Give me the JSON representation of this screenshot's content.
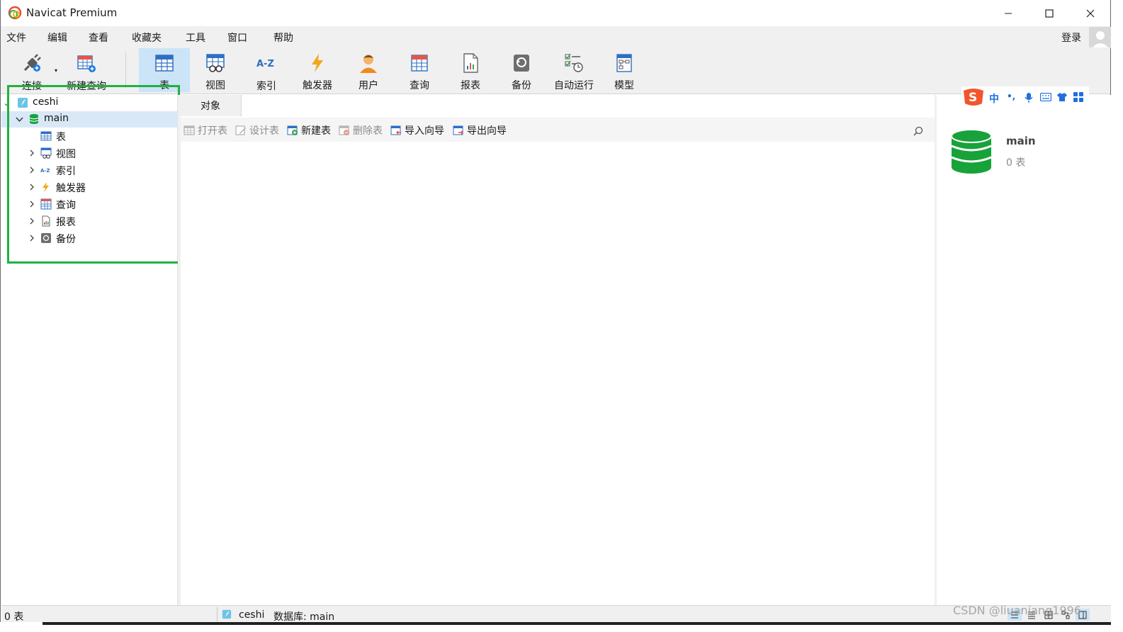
{
  "window": {
    "title": "Navicat Premium",
    "minimize_icon": "minimize-icon",
    "maximize_icon": "maximize-icon",
    "close_icon": "close-icon"
  },
  "menubar": {
    "items": [
      "文件",
      "编辑",
      "查看",
      "收藏夹",
      "工具",
      "窗口",
      "帮助"
    ],
    "login": "登录"
  },
  "toolbar": {
    "buttons": [
      {
        "label": "连接",
        "icon": "connect-plug-icon"
      },
      {
        "label": "新建查询",
        "icon": "new-query-icon"
      },
      {
        "label": "表",
        "icon": "table-icon",
        "active": true
      },
      {
        "label": "视图",
        "icon": "view-icon"
      },
      {
        "label": "索引",
        "icon": "index-az-icon"
      },
      {
        "label": "触发器",
        "icon": "trigger-bolt-icon"
      },
      {
        "label": "用户",
        "icon": "user-icon"
      },
      {
        "label": "查询",
        "icon": "query-icon"
      },
      {
        "label": "报表",
        "icon": "report-icon"
      },
      {
        "label": "备份",
        "icon": "backup-icon"
      },
      {
        "label": "自动运行",
        "icon": "automation-icon"
      },
      {
        "label": "模型",
        "icon": "model-icon"
      }
    ]
  },
  "navigator": {
    "connection": "ceshi",
    "database": "main",
    "items": [
      {
        "label": "表",
        "icon": "table-icon",
        "expandable": false
      },
      {
        "label": "视图",
        "icon": "view-icon",
        "expandable": true
      },
      {
        "label": "索引",
        "icon": "index-az-icon",
        "expandable": true
      },
      {
        "label": "触发器",
        "icon": "trigger-bolt-icon",
        "expandable": true
      },
      {
        "label": "查询",
        "icon": "query-icon",
        "expandable": true
      },
      {
        "label": "报表",
        "icon": "report-icon",
        "expandable": true
      },
      {
        "label": "备份",
        "icon": "backup-icon",
        "expandable": true
      }
    ]
  },
  "tabs": {
    "objects": "对象"
  },
  "object_toolbar": {
    "open_table": "打开表",
    "design_table": "设计表",
    "new_table": "新建表",
    "delete_table": "删除表",
    "import_wizard": "导入向导",
    "export_wizard": "导出向导"
  },
  "info_pane": {
    "name": "main",
    "count": "0 表"
  },
  "ime": {
    "mode": "中",
    "punct": "•,"
  },
  "statusbar": {
    "count": "0 表",
    "connection": "ceshi",
    "database": "数据库: main"
  },
  "watermark": "CSDN @liuaniang1996",
  "colors": {
    "highlight_box": "#1fb141",
    "selected_row": "#d9e8f7",
    "active_tool": "#cce4f7",
    "db_green": "#17a23a"
  }
}
